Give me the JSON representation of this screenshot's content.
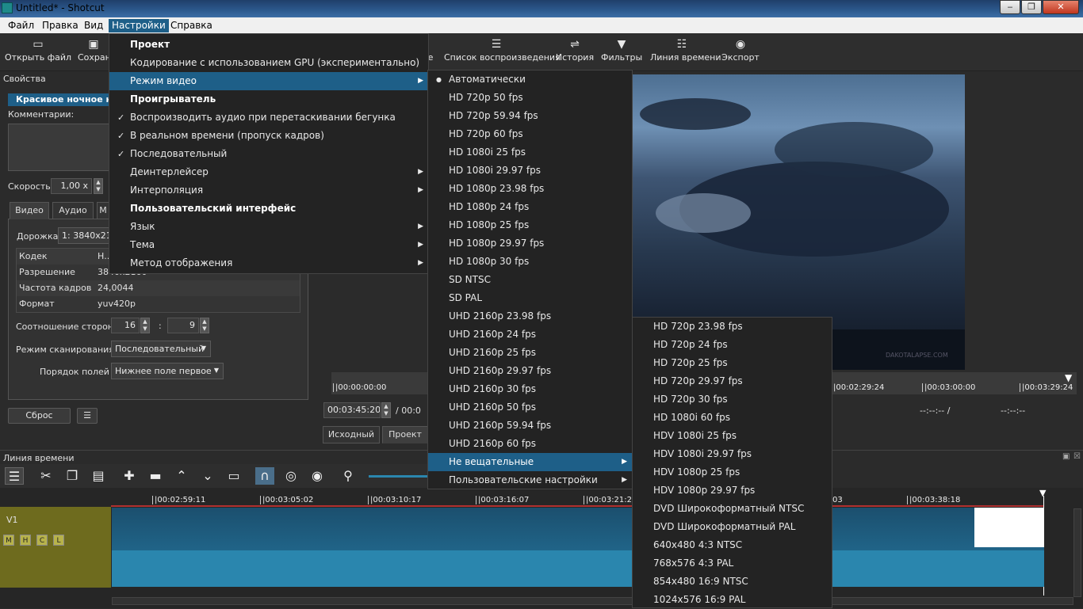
{
  "window": {
    "title": "Untitled* - Shotcut",
    "buttons": [
      "‒",
      "❐",
      "✕"
    ]
  },
  "menubar": [
    "Файл",
    "Правка",
    "Вид",
    "Настройки",
    "Справка"
  ],
  "toolbar": {
    "open": "Открыть файл",
    "save": "Сохран",
    "play_frag": "е",
    "playlist": "Список воспроизведения",
    "history": "История",
    "filters": "Фильтры",
    "timeline": "Линия времени",
    "export": "Экспорт"
  },
  "props": {
    "title": "Свойства",
    "clip_name": "Красивое ночное не",
    "comments_label": "Комментарии:",
    "speed_label": "Скорость",
    "speed": "1,00 x",
    "tabs": [
      "Видео",
      "Аудио",
      "М"
    ],
    "track_label": "Дорожка",
    "track_value": "1: 3840x216",
    "info": [
      {
        "k": "Кодек",
        "v": "Н.."
      },
      {
        "k": "Разрешение",
        "v": "3840x2160"
      },
      {
        "k": "Частота кадров",
        "v": "24,0044"
      },
      {
        "k": "Формат",
        "v": "yuv420p"
      }
    ],
    "aspect_label": "Соотношение сторон",
    "aspect_w": "16",
    "aspect_sep": ":",
    "aspect_h": "9",
    "scan_label": "Режим сканирования",
    "scan_value": "Последовательный",
    "field_label": "Порядок полей",
    "field_value": "Нижнее поле первое",
    "reset": "Сброс",
    "menu_btn": "☰"
  },
  "player": {
    "ticks": [
      "|00:00:00:00",
      "|00:02:29:24",
      "|00:03:00:00",
      "|00:03:29:24"
    ],
    "timecode": "00:03:45:20",
    "total": "/ 00:0",
    "in_point": "--:--:-- /",
    "out_point": "--:--:--",
    "tabs": [
      "Исходный",
      "Проект"
    ],
    "watermark": "DAKOTALAPSE.COM"
  },
  "timeline": {
    "title": "Линия времени",
    "ticks": [
      "|00:02:59:11",
      "|00:03:05:02",
      "|00:03:10:17",
      "|00:03:16:07",
      "|00:03:21:22",
      "03",
      "|00:03:38:18"
    ],
    "track": "V1",
    "mhcl": [
      "M",
      "H",
      "C",
      "L"
    ]
  },
  "settings_menu": {
    "items": [
      {
        "type": "hdr",
        "label": "Проект"
      },
      {
        "label": "Кодирование с использованием GPU (экспериментально)"
      },
      {
        "label": "Режим видео",
        "sub": true,
        "hl": true
      },
      {
        "type": "hdr",
        "label": "Проигрыватель"
      },
      {
        "label": "Воспроизводить аудио при перетаскивании бегунка",
        "check": "✓"
      },
      {
        "label": "В реальном времени (пропуск кадров)",
        "check": "✓"
      },
      {
        "label": "Последовательный",
        "check": "✓"
      },
      {
        "label": "Деинтерлейсер",
        "sub": true
      },
      {
        "label": "Интерполяция",
        "sub": true
      },
      {
        "type": "hdr",
        "label": "Пользовательский интерфейс"
      },
      {
        "label": "Язык",
        "sub": true
      },
      {
        "label": "Тема",
        "sub": true
      },
      {
        "label": "Метод отображения",
        "sub": true
      }
    ]
  },
  "video_mode_menu": {
    "items": [
      "Автоматически",
      "HD 720p 50 fps",
      "HD 720p 59.94 fps",
      "HD 720p 60 fps",
      "HD 1080i 25 fps",
      "HD 1080i 29.97 fps",
      "HD 1080p 23.98 fps",
      "HD 1080p 24 fps",
      "HD 1080p 25 fps",
      "HD 1080p 29.97 fps",
      "HD 1080p 30 fps",
      "SD NTSC",
      "SD PAL",
      "UHD 2160p 23.98 fps",
      "UHD 2160p 24 fps",
      "UHD 2160p 25 fps",
      "UHD 2160p 29.97 fps",
      "UHD 2160p 30 fps",
      "UHD 2160p 50 fps",
      "UHD 2160p 59.94 fps",
      "UHD 2160p 60 fps",
      "Не вещательные",
      "Пользовательские настройки"
    ],
    "selected_marker": "●"
  },
  "nonbroadcast_menu": {
    "items": [
      "HD 720p 23.98 fps",
      "HD 720p 24 fps",
      "HD 720p 25 fps",
      "HD 720p 29.97 fps",
      "HD 720p 30 fps",
      "HD 1080i 60 fps",
      "HDV 1080i 25 fps",
      "HDV 1080i 29.97 fps",
      "HDV 1080p 25 fps",
      "HDV 1080p 29.97 fps",
      "DVD Широкоформатный NTSC",
      "DVD Широкоформатный PAL",
      "640x480 4:3 NTSC",
      "768x576 4:3 PAL",
      "854x480 16:9 NTSC",
      "1024x576 16:9 PAL"
    ]
  },
  "colors": {
    "accent": "#1e5f88",
    "track_head": "#6e6b1e",
    "clip": "#1d5e80"
  }
}
